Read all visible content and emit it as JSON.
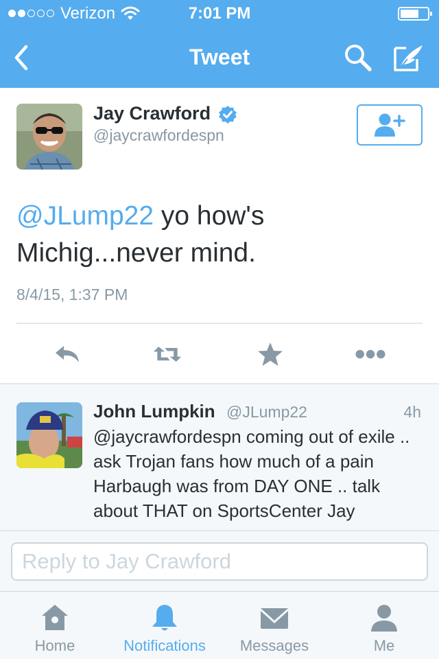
{
  "status_bar": {
    "carrier": "Verizon",
    "time": "7:01 PM",
    "signal_bars_filled": 2,
    "signal_bars_total": 5
  },
  "nav": {
    "title": "Tweet",
    "back_icon": "chevron-left-icon",
    "search_icon": "search-icon",
    "compose_icon": "compose-quill-icon"
  },
  "tweet": {
    "author_name": "Jay Crawford",
    "author_handle": "@jaycrawfordespn",
    "verified": true,
    "mention": "@JLump22",
    "body": " yo how's Michig...never mind.",
    "timestamp": "8/4/15, 1:37 PM",
    "follow_icon": "add-user-icon",
    "actions": [
      "reply-icon",
      "retweet-icon",
      "favorite-star-icon",
      "more-dots-icon"
    ]
  },
  "reply": {
    "author_name": "John Lumpkin",
    "author_handle": "@JLump22",
    "age": "4h",
    "text": "@jaycrawfordespn coming out of exile .. ask Trojan fans how much of a pain Harbaugh was from DAY ONE .. talk about THAT on SportsCenter Jay"
  },
  "reply_box": {
    "placeholder": "Reply to Jay Crawford",
    "value": ""
  },
  "tabs": [
    {
      "label": "Home",
      "icon": "home-icon",
      "active": false
    },
    {
      "label": "Notifications",
      "icon": "bell-icon",
      "active": true
    },
    {
      "label": "Messages",
      "icon": "envelope-icon",
      "active": false
    },
    {
      "label": "Me",
      "icon": "person-icon",
      "active": false
    }
  ],
  "colors": {
    "brand_blue": "#55acee",
    "text_dark": "#292f33",
    "text_gray": "#8899a6",
    "background_light": "#f5f8fa",
    "divider": "#e1e8ed"
  }
}
